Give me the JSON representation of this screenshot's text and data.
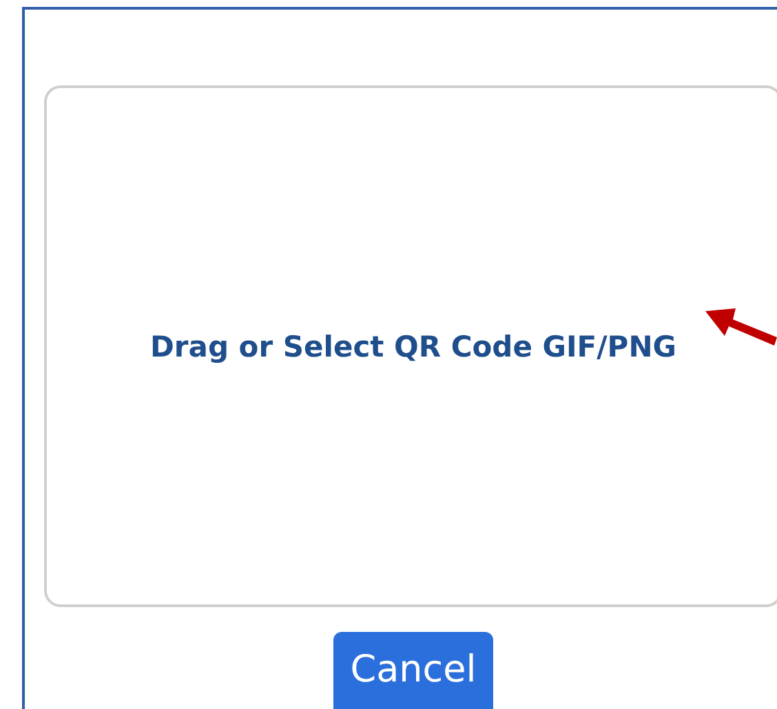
{
  "dropzone": {
    "label": "Drag or Select QR Code GIF/PNG"
  },
  "buttons": [
    {
      "label": "Cancel",
      "kind": "primary"
    }
  ]
}
